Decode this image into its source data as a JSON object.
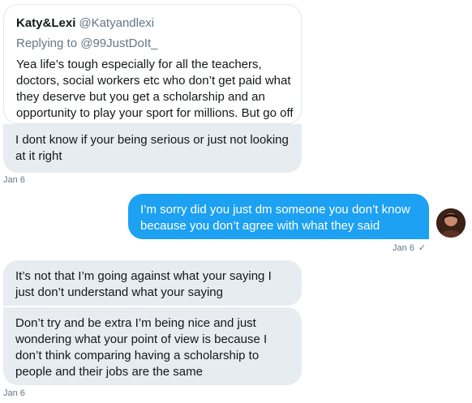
{
  "quoted_tweet": {
    "name": "Katy&Lexi",
    "handle": "@Katyandlexi",
    "replying_prefix": "Replying to",
    "replying_handle": "@99JustDoIt_",
    "text": "Yea life’s tough especially for all the teachers, doctors, social workers etc who don’t get paid what they deserve but you get a scholarship and an opportunity to play your sport for millions. But go off"
  },
  "messages": [
    {
      "direction": "received",
      "text": "I dont know if your being serious or just not looking at it right"
    },
    {
      "direction": "sent",
      "text": "I’m sorry did you just dm someone you don’t know because you don’t agree with what they said"
    },
    {
      "direction": "received",
      "text": "It’s not that I’m going against what your saying I just don’t understand what your saying"
    },
    {
      "direction": "received",
      "text": "Don’t try and be extra I’m being nice and just wondering what your point of view is because I don’t think comparing having a scholarship to people and their jobs are the same"
    }
  ],
  "timestamps": {
    "first": "Jan 6",
    "sent": "Jan 6",
    "sent_status": "✓",
    "last": "Jan 6"
  },
  "colors": {
    "sent_bubble": "#1da1f2",
    "received_bubble": "#e6ecf0",
    "muted_text": "#657786"
  }
}
